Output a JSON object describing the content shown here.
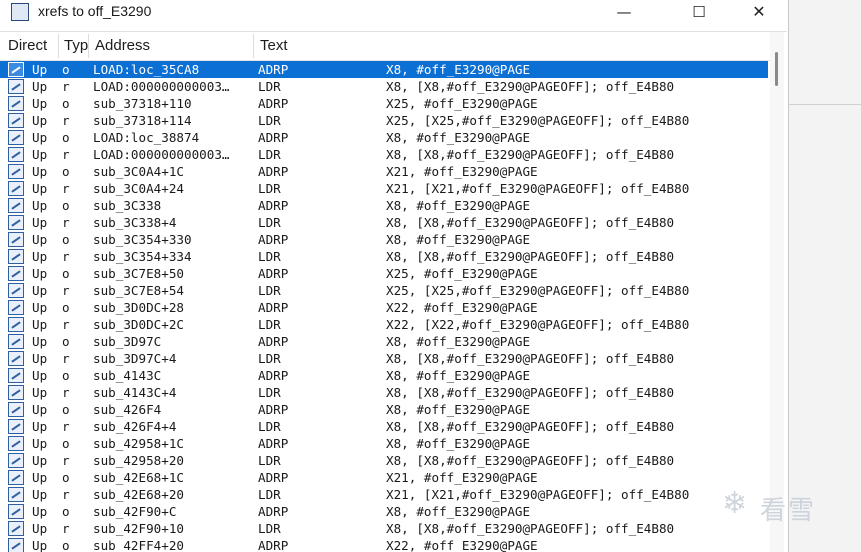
{
  "window": {
    "title": "xrefs to off_E3290",
    "controls": {
      "minimize": "—",
      "maximize": "☐",
      "close": "✕"
    }
  },
  "columns": [
    {
      "label": "Direct"
    },
    {
      "label": "Typ"
    },
    {
      "label": "Address"
    },
    {
      "label": "Text"
    }
  ],
  "rows": [
    {
      "dir": "Up",
      "typ": "o",
      "addr": "LOAD:loc_35CA8",
      "mn": "ADRP",
      "ops": "X8, #off_E3290@PAGE",
      "selected": true
    },
    {
      "dir": "Up",
      "typ": "r",
      "addr": "LOAD:000000000003…",
      "mn": "LDR",
      "ops": "X8, [X8,#off_E3290@PAGEOFF]; off_E4B80"
    },
    {
      "dir": "Up",
      "typ": "o",
      "addr": "sub_37318+110",
      "mn": "ADRP",
      "ops": "X25, #off_E3290@PAGE"
    },
    {
      "dir": "Up",
      "typ": "r",
      "addr": "sub_37318+114",
      "mn": "LDR",
      "ops": "X25, [X25,#off_E3290@PAGEOFF]; off_E4B80"
    },
    {
      "dir": "Up",
      "typ": "o",
      "addr": "LOAD:loc_38874",
      "mn": "ADRP",
      "ops": "X8, #off_E3290@PAGE"
    },
    {
      "dir": "Up",
      "typ": "r",
      "addr": "LOAD:000000000003…",
      "mn": "LDR",
      "ops": "X8, [X8,#off_E3290@PAGEOFF]; off_E4B80"
    },
    {
      "dir": "Up",
      "typ": "o",
      "addr": "sub_3C0A4+1C",
      "mn": "ADRP",
      "ops": "X21, #off_E3290@PAGE"
    },
    {
      "dir": "Up",
      "typ": "r",
      "addr": "sub_3C0A4+24",
      "mn": "LDR",
      "ops": "X21, [X21,#off_E3290@PAGEOFF]; off_E4B80"
    },
    {
      "dir": "Up",
      "typ": "o",
      "addr": "sub_3C338",
      "mn": "ADRP",
      "ops": "X8, #off_E3290@PAGE"
    },
    {
      "dir": "Up",
      "typ": "r",
      "addr": "sub_3C338+4",
      "mn": "LDR",
      "ops": "X8, [X8,#off_E3290@PAGEOFF]; off_E4B80"
    },
    {
      "dir": "Up",
      "typ": "o",
      "addr": "sub_3C354+330",
      "mn": "ADRP",
      "ops": "X8, #off_E3290@PAGE"
    },
    {
      "dir": "Up",
      "typ": "r",
      "addr": "sub_3C354+334",
      "mn": "LDR",
      "ops": "X8, [X8,#off_E3290@PAGEOFF]; off_E4B80"
    },
    {
      "dir": "Up",
      "typ": "o",
      "addr": "sub_3C7E8+50",
      "mn": "ADRP",
      "ops": "X25, #off_E3290@PAGE"
    },
    {
      "dir": "Up",
      "typ": "r",
      "addr": "sub_3C7E8+54",
      "mn": "LDR",
      "ops": "X25, [X25,#off_E3290@PAGEOFF]; off_E4B80"
    },
    {
      "dir": "Up",
      "typ": "o",
      "addr": "sub_3D0DC+28",
      "mn": "ADRP",
      "ops": "X22, #off_E3290@PAGE"
    },
    {
      "dir": "Up",
      "typ": "r",
      "addr": "sub_3D0DC+2C",
      "mn": "LDR",
      "ops": "X22, [X22,#off_E3290@PAGEOFF]; off_E4B80"
    },
    {
      "dir": "Up",
      "typ": "o",
      "addr": "sub_3D97C",
      "mn": "ADRP",
      "ops": "X8, #off_E3290@PAGE"
    },
    {
      "dir": "Up",
      "typ": "r",
      "addr": "sub_3D97C+4",
      "mn": "LDR",
      "ops": "X8, [X8,#off_E3290@PAGEOFF]; off_E4B80"
    },
    {
      "dir": "Up",
      "typ": "o",
      "addr": "sub_4143C",
      "mn": "ADRP",
      "ops": "X8, #off_E3290@PAGE"
    },
    {
      "dir": "Up",
      "typ": "r",
      "addr": "sub_4143C+4",
      "mn": "LDR",
      "ops": "X8, [X8,#off_E3290@PAGEOFF]; off_E4B80"
    },
    {
      "dir": "Up",
      "typ": "o",
      "addr": "sub_426F4",
      "mn": "ADRP",
      "ops": "X8, #off_E3290@PAGE"
    },
    {
      "dir": "Up",
      "typ": "r",
      "addr": "sub_426F4+4",
      "mn": "LDR",
      "ops": "X8, [X8,#off_E3290@PAGEOFF]; off_E4B80"
    },
    {
      "dir": "Up",
      "typ": "o",
      "addr": "sub_42958+1C",
      "mn": "ADRP",
      "ops": "X8, #off_E3290@PAGE"
    },
    {
      "dir": "Up",
      "typ": "r",
      "addr": "sub_42958+20",
      "mn": "LDR",
      "ops": "X8, [X8,#off_E3290@PAGEOFF]; off_E4B80"
    },
    {
      "dir": "Up",
      "typ": "o",
      "addr": "sub_42E68+1C",
      "mn": "ADRP",
      "ops": "X21, #off_E3290@PAGE"
    },
    {
      "dir": "Up",
      "typ": "r",
      "addr": "sub_42E68+20",
      "mn": "LDR",
      "ops": "X21, [X21,#off_E3290@PAGEOFF]; off_E4B80"
    },
    {
      "dir": "Up",
      "typ": "o",
      "addr": "sub_42F90+C",
      "mn": "ADRP",
      "ops": "X8, #off_E3290@PAGE"
    },
    {
      "dir": "Up",
      "typ": "r",
      "addr": "sub_42F90+10",
      "mn": "LDR",
      "ops": "X8, [X8,#off_E3290@PAGEOFF]; off_E4B80"
    },
    {
      "dir": "Up",
      "typ": "o",
      "addr": "sub_42FF4+20",
      "mn": "ADRP",
      "ops": "X22, #off_E3290@PAGE"
    }
  ],
  "watermark": {
    "text": "看雪"
  },
  "colors": {
    "selection": "#0b6fd3",
    "icon_border": "#2f5fa0"
  }
}
